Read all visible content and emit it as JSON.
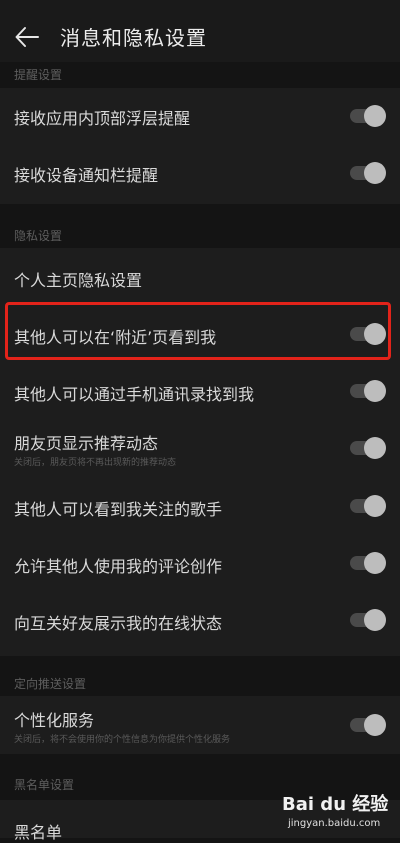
{
  "header": {
    "title": "消息和隐私设置",
    "back_icon": "back-arrow-icon"
  },
  "sections": {
    "reminder": {
      "label": "提醒设置"
    },
    "privacy": {
      "label": "隐私设置"
    },
    "push": {
      "label": "定向推送设置"
    },
    "blacklist": {
      "label": "黑名单设置"
    }
  },
  "items": {
    "in_app": {
      "label": "接收应用内顶部浮层提醒",
      "enabled": true
    },
    "notif_bar": {
      "label": "接收设备通知栏提醒",
      "enabled": true
    },
    "profile_privacy": {
      "label": "个人主页隐私设置"
    },
    "nearby": {
      "label": "其他人可以在‘附近’页看到我",
      "enabled": true
    },
    "contacts": {
      "label": "其他人可以通过手机通讯录找到我",
      "enabled": true
    },
    "friends_feed": {
      "label": "朋友页显示推荐动态",
      "sub": "关闭后，朋友页将不再出现新的推荐动态",
      "enabled": true
    },
    "followed_singers": {
      "label": "其他人可以看到我关注的歌手",
      "enabled": true
    },
    "comment_creation": {
      "label": "允许其他人使用我的评论创作",
      "enabled": true
    },
    "online_status": {
      "label": "向互关好友展示我的在线状态",
      "enabled": true
    },
    "personalized": {
      "label": "个性化服务",
      "sub": "关闭后，将不会使用你的个性信息为你提供个性化服务",
      "enabled": true
    },
    "blacklist": {
      "label": "黑名单"
    }
  },
  "watermark": {
    "main": "Bai du 经验",
    "sub": "jingyan.baidu.com"
  },
  "colors": {
    "highlight": "#e2231a",
    "background": "#141414",
    "card": "#1d1d1d"
  }
}
